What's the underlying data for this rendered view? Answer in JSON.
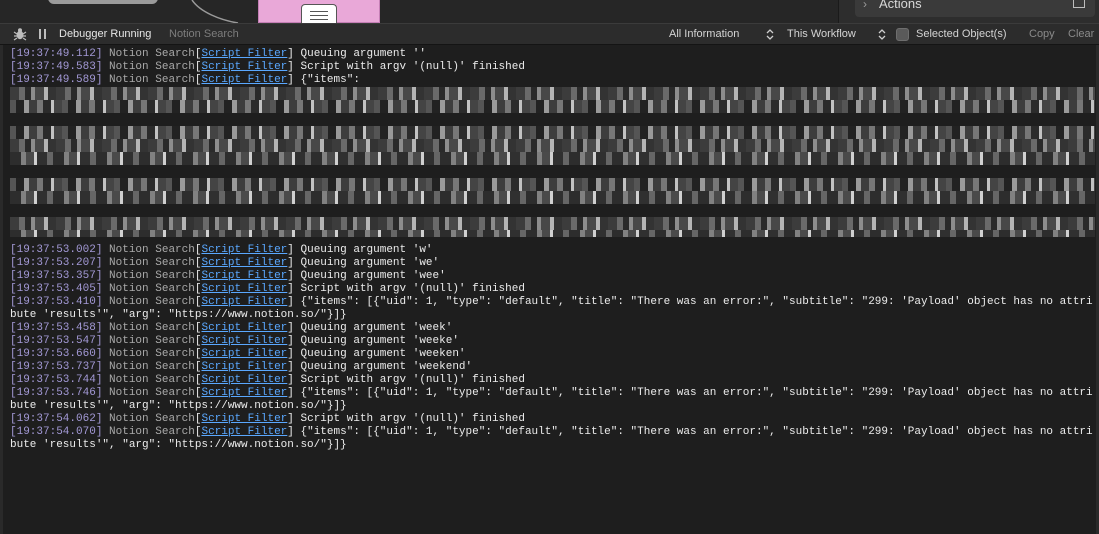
{
  "right_panel": {
    "title": "Actions",
    "chevron": "›"
  },
  "toolbar": {
    "status": "Debugger Running",
    "workflow_name": "Notion Search",
    "filter_info": "All Information",
    "filter_scope": "This Workflow",
    "selected_objects_label": "Selected Object(s)",
    "selected_objects_checked": false,
    "copy_label": "Copy",
    "clear_label": "Clear"
  },
  "colors": {
    "timestamp": "#a399d6",
    "script_filter_link": "#5aa8ff",
    "log_text": "#ececec"
  },
  "log": {
    "source": "Notion Search",
    "object": "Script Filter",
    "lines_top": [
      {
        "ts": "[19:37:49.112]",
        "msg": " Queuing argument ''"
      },
      {
        "ts": "[19:37:49.583]",
        "msg": " Script with argv '(null)' finished"
      },
      {
        "ts": "[19:37:49.589]",
        "msg": " {\"items\":"
      }
    ],
    "lines_bottom": [
      {
        "ts": "[19:37:53.002]",
        "msg": " Queuing argument 'w'"
      },
      {
        "ts": "[19:37:53.207]",
        "msg": " Queuing argument 'we'"
      },
      {
        "ts": "[19:37:53.357]",
        "msg": " Queuing argument 'wee'"
      },
      {
        "ts": "[19:37:53.405]",
        "msg": " Script with argv '(null)' finished"
      },
      {
        "ts": "[19:37:53.410]",
        "msg": " {\"items\": [{\"uid\": 1, \"type\": \"default\", \"title\": \"There was an error:\", \"subtitle\": \"299: 'Payload' object has no attribute 'results'\", \"arg\": \"https://www.notion.so/\"}]}"
      },
      {
        "ts": "[19:37:53.458]",
        "msg": " Queuing argument 'week'"
      },
      {
        "ts": "[19:37:53.547]",
        "msg": " Queuing argument 'weeke'"
      },
      {
        "ts": "[19:37:53.660]",
        "msg": " Queuing argument 'weeken'"
      },
      {
        "ts": "[19:37:53.737]",
        "msg": " Queuing argument 'weekend'"
      },
      {
        "ts": "[19:37:53.744]",
        "msg": " Script with argv '(null)' finished"
      },
      {
        "ts": "[19:37:53.746]",
        "msg": " {\"items\": [{\"uid\": 1, \"type\": \"default\", \"title\": \"There was an error:\", \"subtitle\": \"299: 'Payload' object has no attribute 'results'\", \"arg\": \"https://www.notion.so/\"}]}"
      },
      {
        "ts": "[19:37:54.062]",
        "msg": " Script with argv '(null)' finished"
      },
      {
        "ts": "[19:37:54.070]",
        "msg": " {\"items\": [{\"uid\": 1, \"type\": \"default\", \"title\": \"There was an error:\", \"subtitle\": \"299: 'Payload' object has no attribute 'results'\", \"arg\": \"https://www.notion.so/\"}]}"
      }
    ]
  }
}
